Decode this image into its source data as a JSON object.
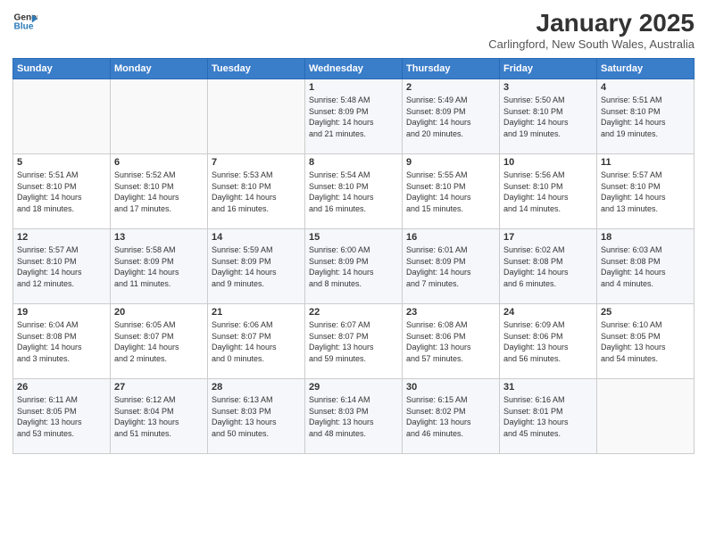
{
  "logo": {
    "line1": "General",
    "line2": "Blue"
  },
  "title": "January 2025",
  "subtitle": "Carlingford, New South Wales, Australia",
  "days_header": [
    "Sunday",
    "Monday",
    "Tuesday",
    "Wednesday",
    "Thursday",
    "Friday",
    "Saturday"
  ],
  "weeks": [
    [
      {
        "day": "",
        "info": ""
      },
      {
        "day": "",
        "info": ""
      },
      {
        "day": "",
        "info": ""
      },
      {
        "day": "1",
        "info": "Sunrise: 5:48 AM\nSunset: 8:09 PM\nDaylight: 14 hours\nand 21 minutes."
      },
      {
        "day": "2",
        "info": "Sunrise: 5:49 AM\nSunset: 8:09 PM\nDaylight: 14 hours\nand 20 minutes."
      },
      {
        "day": "3",
        "info": "Sunrise: 5:50 AM\nSunset: 8:10 PM\nDaylight: 14 hours\nand 19 minutes."
      },
      {
        "day": "4",
        "info": "Sunrise: 5:51 AM\nSunset: 8:10 PM\nDaylight: 14 hours\nand 19 minutes."
      }
    ],
    [
      {
        "day": "5",
        "info": "Sunrise: 5:51 AM\nSunset: 8:10 PM\nDaylight: 14 hours\nand 18 minutes."
      },
      {
        "day": "6",
        "info": "Sunrise: 5:52 AM\nSunset: 8:10 PM\nDaylight: 14 hours\nand 17 minutes."
      },
      {
        "day": "7",
        "info": "Sunrise: 5:53 AM\nSunset: 8:10 PM\nDaylight: 14 hours\nand 16 minutes."
      },
      {
        "day": "8",
        "info": "Sunrise: 5:54 AM\nSunset: 8:10 PM\nDaylight: 14 hours\nand 16 minutes."
      },
      {
        "day": "9",
        "info": "Sunrise: 5:55 AM\nSunset: 8:10 PM\nDaylight: 14 hours\nand 15 minutes."
      },
      {
        "day": "10",
        "info": "Sunrise: 5:56 AM\nSunset: 8:10 PM\nDaylight: 14 hours\nand 14 minutes."
      },
      {
        "day": "11",
        "info": "Sunrise: 5:57 AM\nSunset: 8:10 PM\nDaylight: 14 hours\nand 13 minutes."
      }
    ],
    [
      {
        "day": "12",
        "info": "Sunrise: 5:57 AM\nSunset: 8:10 PM\nDaylight: 14 hours\nand 12 minutes."
      },
      {
        "day": "13",
        "info": "Sunrise: 5:58 AM\nSunset: 8:09 PM\nDaylight: 14 hours\nand 11 minutes."
      },
      {
        "day": "14",
        "info": "Sunrise: 5:59 AM\nSunset: 8:09 PM\nDaylight: 14 hours\nand 9 minutes."
      },
      {
        "day": "15",
        "info": "Sunrise: 6:00 AM\nSunset: 8:09 PM\nDaylight: 14 hours\nand 8 minutes."
      },
      {
        "day": "16",
        "info": "Sunrise: 6:01 AM\nSunset: 8:09 PM\nDaylight: 14 hours\nand 7 minutes."
      },
      {
        "day": "17",
        "info": "Sunrise: 6:02 AM\nSunset: 8:08 PM\nDaylight: 14 hours\nand 6 minutes."
      },
      {
        "day": "18",
        "info": "Sunrise: 6:03 AM\nSunset: 8:08 PM\nDaylight: 14 hours\nand 4 minutes."
      }
    ],
    [
      {
        "day": "19",
        "info": "Sunrise: 6:04 AM\nSunset: 8:08 PM\nDaylight: 14 hours\nand 3 minutes."
      },
      {
        "day": "20",
        "info": "Sunrise: 6:05 AM\nSunset: 8:07 PM\nDaylight: 14 hours\nand 2 minutes."
      },
      {
        "day": "21",
        "info": "Sunrise: 6:06 AM\nSunset: 8:07 PM\nDaylight: 14 hours\nand 0 minutes."
      },
      {
        "day": "22",
        "info": "Sunrise: 6:07 AM\nSunset: 8:07 PM\nDaylight: 13 hours\nand 59 minutes."
      },
      {
        "day": "23",
        "info": "Sunrise: 6:08 AM\nSunset: 8:06 PM\nDaylight: 13 hours\nand 57 minutes."
      },
      {
        "day": "24",
        "info": "Sunrise: 6:09 AM\nSunset: 8:06 PM\nDaylight: 13 hours\nand 56 minutes."
      },
      {
        "day": "25",
        "info": "Sunrise: 6:10 AM\nSunset: 8:05 PM\nDaylight: 13 hours\nand 54 minutes."
      }
    ],
    [
      {
        "day": "26",
        "info": "Sunrise: 6:11 AM\nSunset: 8:05 PM\nDaylight: 13 hours\nand 53 minutes."
      },
      {
        "day": "27",
        "info": "Sunrise: 6:12 AM\nSunset: 8:04 PM\nDaylight: 13 hours\nand 51 minutes."
      },
      {
        "day": "28",
        "info": "Sunrise: 6:13 AM\nSunset: 8:03 PM\nDaylight: 13 hours\nand 50 minutes."
      },
      {
        "day": "29",
        "info": "Sunrise: 6:14 AM\nSunset: 8:03 PM\nDaylight: 13 hours\nand 48 minutes."
      },
      {
        "day": "30",
        "info": "Sunrise: 6:15 AM\nSunset: 8:02 PM\nDaylight: 13 hours\nand 46 minutes."
      },
      {
        "day": "31",
        "info": "Sunrise: 6:16 AM\nSunset: 8:01 PM\nDaylight: 13 hours\nand 45 minutes."
      },
      {
        "day": "",
        "info": ""
      }
    ]
  ]
}
